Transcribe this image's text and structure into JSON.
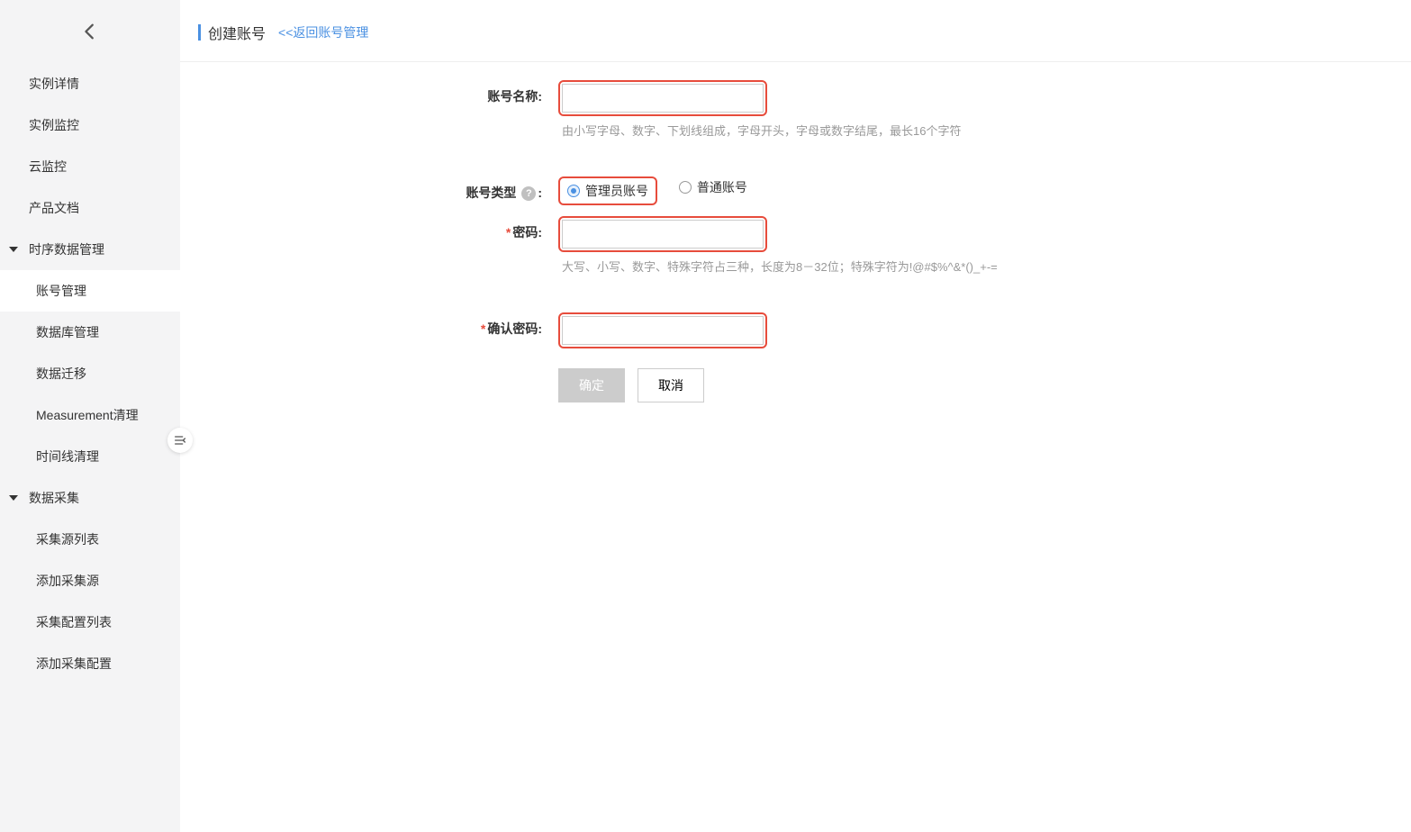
{
  "sidebar": {
    "items_top": [
      {
        "label": "实例详情"
      },
      {
        "label": "实例监控"
      },
      {
        "label": "云监控"
      },
      {
        "label": "产品文档"
      }
    ],
    "group_tsdata": {
      "label": "时序数据管理",
      "children": [
        {
          "label": "账号管理",
          "active": true
        },
        {
          "label": "数据库管理"
        },
        {
          "label": "数据迁移"
        },
        {
          "label": "Measurement清理"
        },
        {
          "label": "时间线清理"
        }
      ]
    },
    "group_collect": {
      "label": "数据采集",
      "children": [
        {
          "label": "采集源列表"
        },
        {
          "label": "添加采集源"
        },
        {
          "label": "采集配置列表"
        },
        {
          "label": "添加采集配置"
        }
      ]
    }
  },
  "header": {
    "title": "创建账号",
    "back_link": "<<返回账号管理"
  },
  "form": {
    "account_name": {
      "label": "账号名称:",
      "hint": "由小写字母、数字、下划线组成，字母开头，字母或数字结尾，最长16个字符"
    },
    "account_type": {
      "label": "账号类型",
      "colon": ":",
      "option_admin": "管理员账号",
      "option_normal": "普通账号"
    },
    "password": {
      "label": "密码:",
      "hint": "大写、小写、数字、特殊字符占三种，长度为8－32位；特殊字符为!@#$%^&*()_+-="
    },
    "confirm_password": {
      "label": "确认密码:"
    },
    "buttons": {
      "confirm": "确定",
      "cancel": "取消"
    }
  }
}
